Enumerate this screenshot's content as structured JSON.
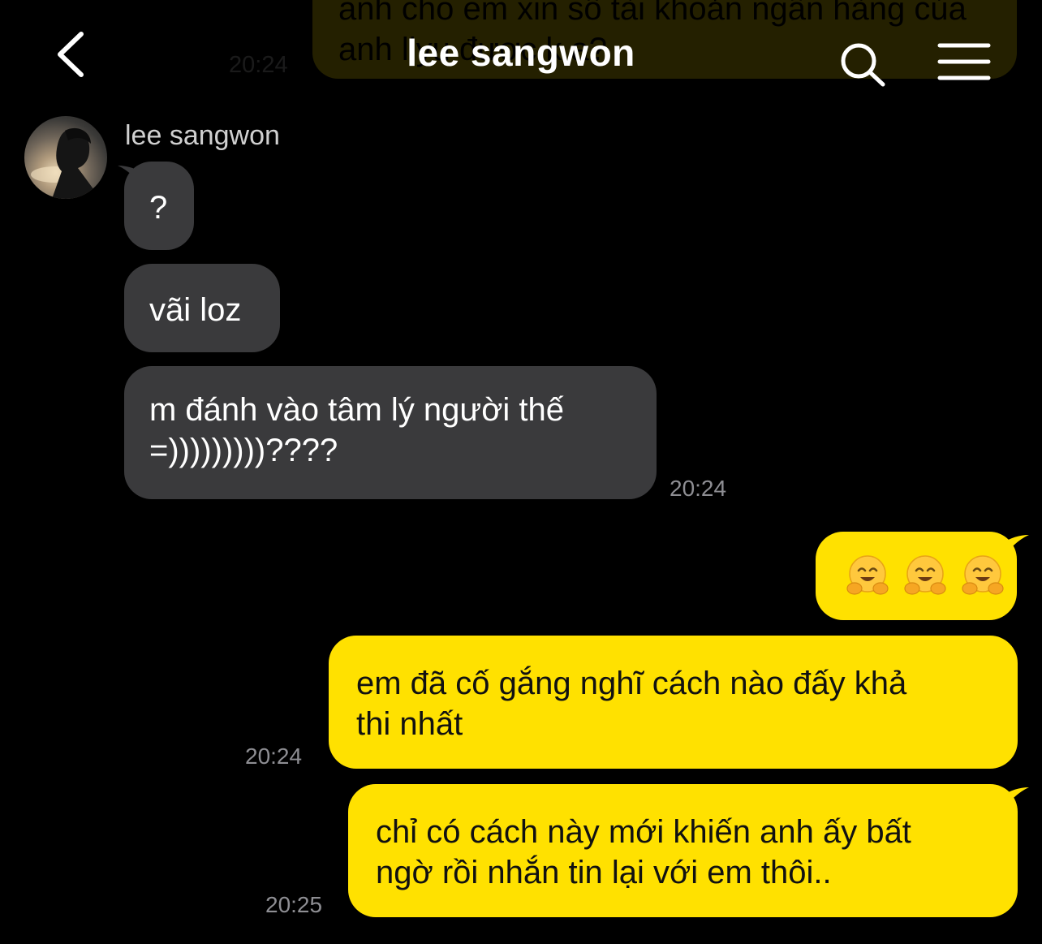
{
  "header": {
    "title": "lee sangwon",
    "back_icon": "chevron-left-icon",
    "search_icon": "search-icon",
    "menu_icon": "hamburger-menu-icon"
  },
  "previous_message": {
    "text": "anh cho em xin số tài khoản ngân hàng của anh liyu được k ạ?",
    "time": "20:24"
  },
  "incoming": {
    "sender_name": "lee sangwon",
    "messages": [
      {
        "text": "?"
      },
      {
        "text": "vãi loz"
      },
      {
        "line1": "m đánh vào tâm lý người thế",
        "line2": "=)))))))))????",
        "time": "20:24"
      }
    ]
  },
  "outgoing": {
    "emoji_message": {
      "emoji_count": 3,
      "emoji_name": "hugging-face-emoji"
    },
    "messages": [
      {
        "line1": "em đã cố gắng nghĩ cách nào đấy khả",
        "line2": "thi nhất",
        "time": "20:24"
      },
      {
        "line1": "chỉ có cách này mới khiến anh ấy bất",
        "line2": "ngờ rồi nhắn tin lại với em thôi..",
        "time": "20:25"
      }
    ]
  },
  "colors": {
    "background": "#000000",
    "incoming_bubble": "#3a3a3c",
    "outgoing_bubble": "#FFE100",
    "timestamp": "#8e8e93"
  }
}
